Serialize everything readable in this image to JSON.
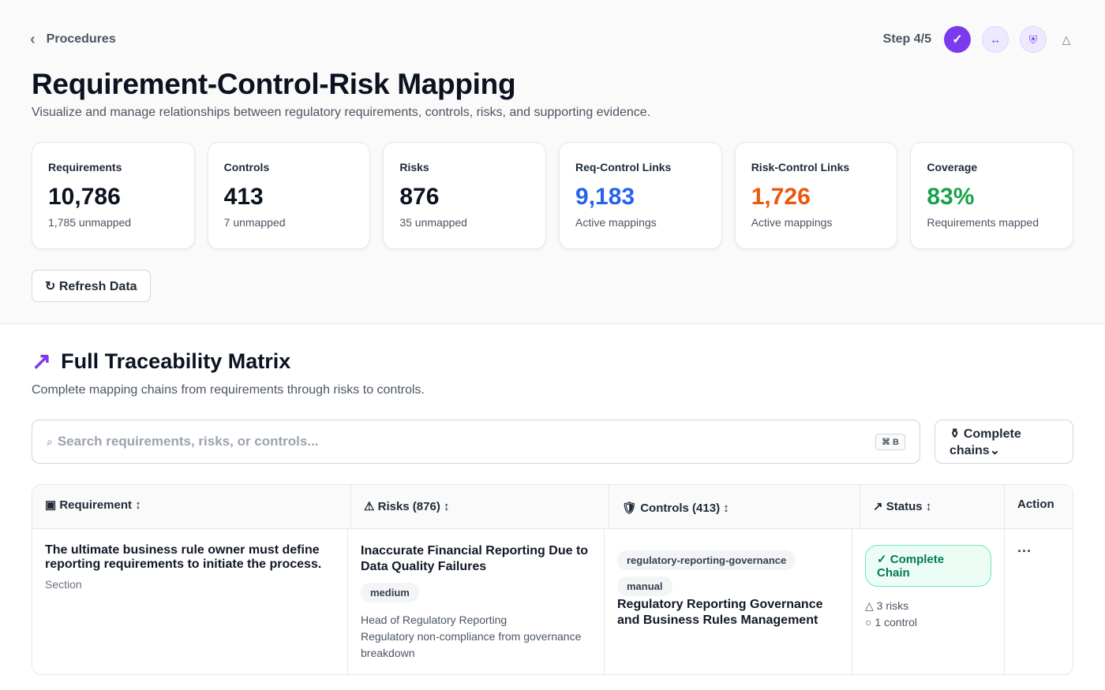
{
  "nav": {
    "back_label": "Procedures"
  },
  "steps": {
    "label": "Step 4/5",
    "active_glyph": "✓",
    "glyph_2": "↔",
    "glyph_3": "⛨",
    "glyph_4": "△"
  },
  "header": {
    "title": "Requirement-Control-Risk Mapping",
    "subtitle": "Visualize and manage relationships between regulatory requirements, controls, risks, and supporting evidence."
  },
  "cards": [
    {
      "label": "Requirements",
      "value": "10,786",
      "note": "1,785 unmapped",
      "color": "#0b1220"
    },
    {
      "label": "Controls",
      "value": "413",
      "note": "7 unmapped",
      "color": "#0b1220"
    },
    {
      "label": "Risks",
      "value": "876",
      "note": "35 unmapped",
      "color": "#0b1220"
    },
    {
      "label": "Req-Control Links",
      "value": "9,183",
      "note": "Active mappings",
      "color": "#2563eb"
    },
    {
      "label": "Risk-Control Links",
      "value": "1,726",
      "note": "Active mappings",
      "color": "#ea580c"
    },
    {
      "label": "Coverage",
      "value": "83%",
      "note": "Requirements mapped",
      "color": "#16a34a"
    }
  ],
  "refresh_label": "↻ Refresh Data",
  "section": {
    "icon": "↗",
    "title": "Full Traceability Matrix",
    "subtitle": "Complete mapping chains from requirements through risks to controls."
  },
  "search": {
    "icon": "⌕",
    "placeholder": "Search requirements, risks, or controls...",
    "shortcut": "⌘ B"
  },
  "filter": {
    "line1": "⚱ Complete",
    "line2": "chains⌄"
  },
  "table": {
    "headers": {
      "requirement": "▣ Requirement ↕",
      "risks": "⚠ Risks (876) ↕",
      "controls": "🛡 Controls (413) ↕",
      "status": "↗ Status ↕",
      "action": "Action"
    },
    "row": {
      "requirement": "The ultimate business rule owner must define reporting requirements to initiate the process.",
      "requirement_type": "Section",
      "risk_title": "Inaccurate Financial Reporting Due to Data Quality Failures",
      "risk_level": "medium",
      "risk_owner": "Head of Regulatory Reporting",
      "risk_desc": "Regulatory non-compliance from governance breakdown",
      "control_tag": "regulatory-reporting-governance",
      "control_type": "manual",
      "control_title": "Regulatory Reporting Governance and Business Rules Management",
      "status": "✓ Complete Chain",
      "risk_count": "△ 3 risks",
      "control_count": "○ 1 control",
      "action": "···"
    }
  }
}
